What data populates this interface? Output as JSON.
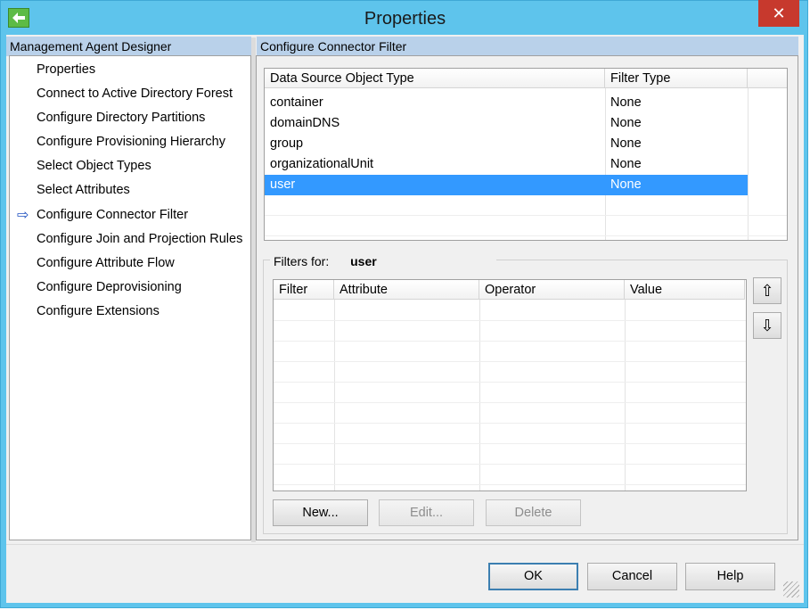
{
  "window": {
    "title": "Properties",
    "app_icon": "back-arrow-icon",
    "close_glyph": "✕"
  },
  "left_pane": {
    "header": "Management Agent Designer",
    "current_marker": "⇨",
    "items": [
      "Properties",
      "Connect to Active Directory Forest",
      "Configure Directory Partitions",
      "Configure Provisioning Hierarchy",
      "Select Object Types",
      "Select Attributes",
      "Configure Connector Filter",
      "Configure Join and Projection Rules",
      "Configure Attribute Flow",
      "Configure Deprovisioning",
      "Configure Extensions"
    ],
    "current_index": 6
  },
  "right_pane": {
    "header": "Configure Connector Filter",
    "object_grid": {
      "columns": [
        "Data Source Object Type",
        "Filter Type"
      ],
      "rows": [
        [
          "container",
          "None"
        ],
        [
          "domainDNS",
          "None"
        ],
        [
          "group",
          "None"
        ],
        [
          "organizationalUnit",
          "None"
        ],
        [
          "user",
          "None"
        ]
      ],
      "selected_index": 4
    },
    "filters": {
      "label": "Filters for:",
      "object": "user",
      "columns": [
        "Filter",
        "Attribute",
        "Operator",
        "Value"
      ],
      "up_glyph": "⇧",
      "down_glyph": "⇩",
      "buttons": {
        "new": "New...",
        "edit": "Edit...",
        "delete": "Delete"
      }
    }
  },
  "footer": {
    "ok": "OK",
    "cancel": "Cancel",
    "help": "Help"
  },
  "colors": {
    "title_bar": "#5ec4ec",
    "header": "#b9d1ea",
    "selection": "#3399ff",
    "close": "#c7392d"
  }
}
